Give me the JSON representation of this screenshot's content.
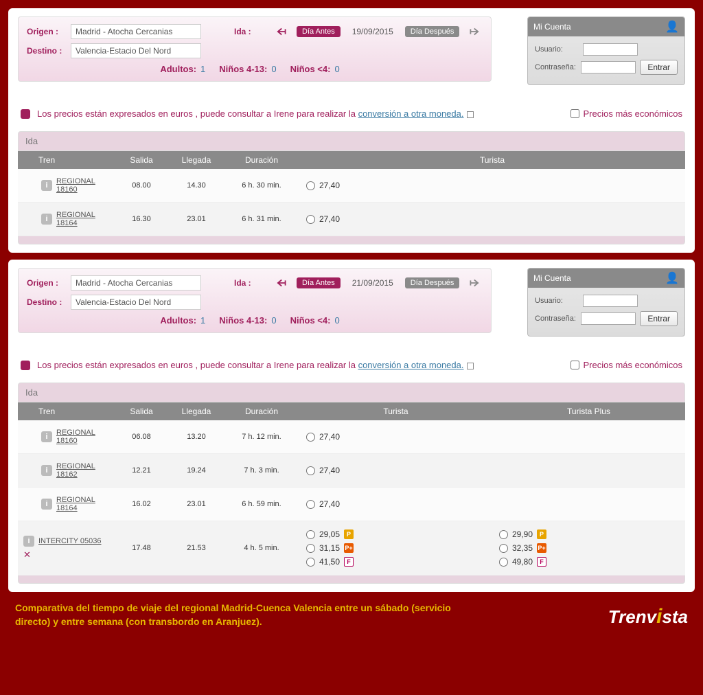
{
  "labels": {
    "origen": "Origen :",
    "destino": "Destino :",
    "ida": "Ida :",
    "dia_antes": "Día Antes",
    "dia_despues": "Día Después",
    "adultos": "Adultos:",
    "ninos413": "Niños 4-13:",
    "ninos4": "Niños <4:",
    "mi_cuenta": "Mi Cuenta",
    "usuario": "Usuario:",
    "contrasena": "Contraseña:",
    "entrar": "Entrar",
    "notice_pre": "Los precios están expresados en euros , puede consultar a Irene para realizar la ",
    "notice_link": " conversión a otra moneda.",
    "economicos": "Precios más económicos",
    "ida_head": "Ida",
    "h_tren": "Tren",
    "h_salida": "Salida",
    "h_llegada": "Llegada",
    "h_duracion": "Duración",
    "h_turista": "Turista",
    "h_turista_plus": "Turista Plus"
  },
  "origen_val": "Madrid - Atocha Cercanias",
  "destino_val": "Valencia-Estacio Del Nord",
  "adultos_val": "1",
  "ninos413_val": "0",
  "ninos4_val": "0",
  "panel1": {
    "date": "19/09/2015",
    "show_turista_plus": false,
    "rows": [
      {
        "train": "REGIONAL 18160",
        "salida": "08.00",
        "llegada": "14.30",
        "dur": "6 h. 30 min.",
        "turista": [
          {
            "price": "27,40"
          }
        ],
        "turista_plus": []
      },
      {
        "train": "REGIONAL 18164",
        "salida": "16.30",
        "llegada": "23.01",
        "dur": "6 h. 31 min.",
        "turista": [
          {
            "price": "27,40"
          }
        ],
        "turista_plus": []
      }
    ]
  },
  "panel2": {
    "date": "21/09/2015",
    "show_turista_plus": true,
    "rows": [
      {
        "train": "REGIONAL 18160",
        "salida": "06.08",
        "llegada": "13.20",
        "dur": "7 h. 12 min.",
        "turista": [
          {
            "price": "27,40"
          }
        ],
        "turista_plus": []
      },
      {
        "train": "REGIONAL 18162",
        "salida": "12.21",
        "llegada": "19.24",
        "dur": "7 h. 3 min.",
        "turista": [
          {
            "price": "27,40"
          }
        ],
        "turista_plus": []
      },
      {
        "train": "REGIONAL 18164",
        "salida": "16.02",
        "llegada": "23.01",
        "dur": "6 h. 59 min.",
        "turista": [
          {
            "price": "27,40"
          }
        ],
        "turista_plus": []
      },
      {
        "train": "INTERCITY 05036",
        "salida": "17.48",
        "llegada": "21.53",
        "dur": "4 h. 5 min.",
        "restaurant": true,
        "turista": [
          {
            "price": "29,05",
            "badge": "P"
          },
          {
            "price": "31,15",
            "badge": "P+"
          },
          {
            "price": "41,50",
            "badge": "F"
          }
        ],
        "turista_plus": [
          {
            "price": "29,90",
            "badge": "P"
          },
          {
            "price": "32,35",
            "badge": "P+"
          },
          {
            "price": "49,80",
            "badge": "F"
          }
        ]
      }
    ]
  },
  "caption": "Comparativa del tiempo de viaje del regional Madrid-Cuenca Valencia entre un sábado (servicio directo) y entre semana (con transbordo en Aranjuez).",
  "brand_pre": "Trenv",
  "brand_post": "sta"
}
